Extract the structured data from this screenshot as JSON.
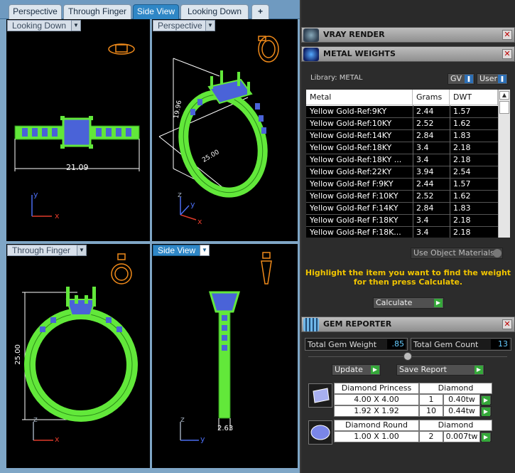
{
  "tabs": [
    {
      "label": "Perspective"
    },
    {
      "label": "Through Finger"
    },
    {
      "label": "Side View"
    },
    {
      "label": "Looking Down"
    },
    {
      "label": "+"
    }
  ],
  "viewports": {
    "top_left": {
      "label": "Looking Down",
      "dimension": "21.09",
      "axis_x": "x",
      "axis_y": "y"
    },
    "top_right": {
      "label": "Perspective",
      "dim_a": "19.96",
      "dim_b": "25.00",
      "axis_x": "x",
      "axis_y": "y",
      "axis_z": "z"
    },
    "bottom_left": {
      "label": "Through Finger",
      "dimension": "25.00",
      "axis_x": "x",
      "axis_z": "z"
    },
    "bottom_right": {
      "label": "Side View",
      "dimension": "2.63",
      "axis_y": "y",
      "axis_z": "z"
    }
  },
  "vray": {
    "title": "VRAY RENDER",
    "icon": "vray-logo-icon"
  },
  "metal_weights": {
    "title": "METAL WEIGHTS",
    "library_label": "Library: METAL",
    "gv_label": "GV",
    "user_label": "User",
    "columns": [
      "Metal",
      "Grams",
      "DWT"
    ],
    "rows": [
      {
        "metal": "Yellow Gold-Ref:9KY",
        "grams": "2.44",
        "dwt": "1.57"
      },
      {
        "metal": "Yellow Gold-Ref:10KY",
        "grams": "2.52",
        "dwt": "1.62"
      },
      {
        "metal": "Yellow Gold-Ref:14KY",
        "grams": "2.84",
        "dwt": "1.83"
      },
      {
        "metal": "Yellow Gold-Ref:18KY",
        "grams": "3.4",
        "dwt": "2.18"
      },
      {
        "metal": "Yellow Gold-Ref:18KY ...",
        "grams": "3.4",
        "dwt": "2.18"
      },
      {
        "metal": "Yellow Gold-Ref:22KY",
        "grams": "3.94",
        "dwt": "2.54"
      },
      {
        "metal": "Yellow Gold-Ref F:9KY",
        "grams": "2.44",
        "dwt": "1.57"
      },
      {
        "metal": "Yellow Gold-Ref F:10KY",
        "grams": "2.52",
        "dwt": "1.62"
      },
      {
        "metal": "Yellow Gold-Ref F:14KY",
        "grams": "2.84",
        "dwt": "1.83"
      },
      {
        "metal": "Yellow Gold-Ref F:18KY",
        "grams": "3.4",
        "dwt": "2.18"
      },
      {
        "metal": "Yellow Gold-Ref F:18K...",
        "grams": "3.4",
        "dwt": "2.18"
      }
    ],
    "use_object_materials": "Use Object Materials",
    "instruction_line1": "Highlight the item you want to find the weight",
    "instruction_line2": "for then press Calculate.",
    "calculate_label": "Calculate",
    "instruction_color": "#f0c400"
  },
  "gem_reporter": {
    "title": "GEM REPORTER",
    "total_weight_label": "Total Gem Weight",
    "total_weight_value": ".85",
    "total_count_label": "Total Gem Count",
    "total_count_value": "13",
    "update_label": "Update",
    "save_report_label": "Save Report",
    "groups": [
      {
        "shape": "Diamond Princess",
        "material": "Diamond",
        "rows": [
          {
            "size": "4.00 X 4.00",
            "count": "1",
            "weight": "0.40tw"
          },
          {
            "size": "1.92 X 1.92",
            "count": "10",
            "weight": "0.44tw"
          }
        ]
      },
      {
        "shape": "Diamond Round",
        "material": "Diamond",
        "rows": [
          {
            "size": "1.00 X 1.00",
            "count": "2",
            "weight": "0.007tw"
          }
        ]
      }
    ]
  },
  "colors": {
    "metal_green": "#62e83a",
    "stone_blue": "#4a63d8",
    "dimension_white": "#ffffff",
    "axis_x": "#e03a2a",
    "axis_y": "#4a6cf0",
    "gizmo_orange": "#f08a1a",
    "active_tab": "#2f87c6"
  }
}
